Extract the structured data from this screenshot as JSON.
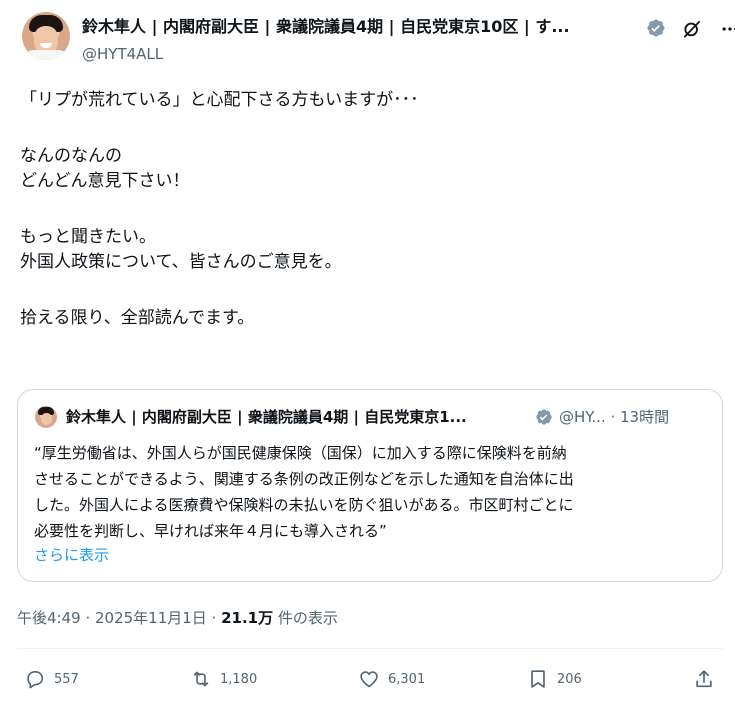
{
  "author": {
    "display_name": "鈴木隼人 | 内閣府副大臣 | 衆議院議員4期 | 自民党東京10区 | す...",
    "handle": "@HYT4ALL"
  },
  "tweet": {
    "lines": [
      "「リプが荒れている」と心配下さる方もいますが･･･",
      "なんのなんの",
      "どんどん意見下さい！",
      "もっと聞きたい。",
      "外国人政策について、皆さんのご意見を。",
      "拾える限り、全部読んでます。"
    ]
  },
  "quote": {
    "display_name": "鈴木隼人 | 内閣府副大臣 | 衆議院議員4期 | 自民党東京1...",
    "meta": "@HY... · 13時間",
    "lines": [
      "“厚生労働省は、外国人らが国民健康保険（国保）に加入する際に保険料を前納",
      "させることができるよう、関連する条例の改正例などを示した通知を自治体に出",
      "した。外国人による医療費や保険料の未払いを防ぐ狙いがある。市区町村ごとに",
      "必要性を判断し、早ければ来年４月にも導入される”"
    ],
    "show_more": "さらに表示"
  },
  "timestamp": {
    "time_date": "午後4:49 · 2025年11月1日 · ",
    "views_count": "21.1万",
    "views_label": " 件の表示"
  },
  "actions": {
    "replies": "557",
    "reposts": "1,180",
    "likes": "6,301",
    "bookmarks": "206"
  },
  "colors": {
    "verified": "#829aab",
    "link": "#1d9bf0",
    "secondary_text": "#536471",
    "primary_text": "#0f1419"
  }
}
